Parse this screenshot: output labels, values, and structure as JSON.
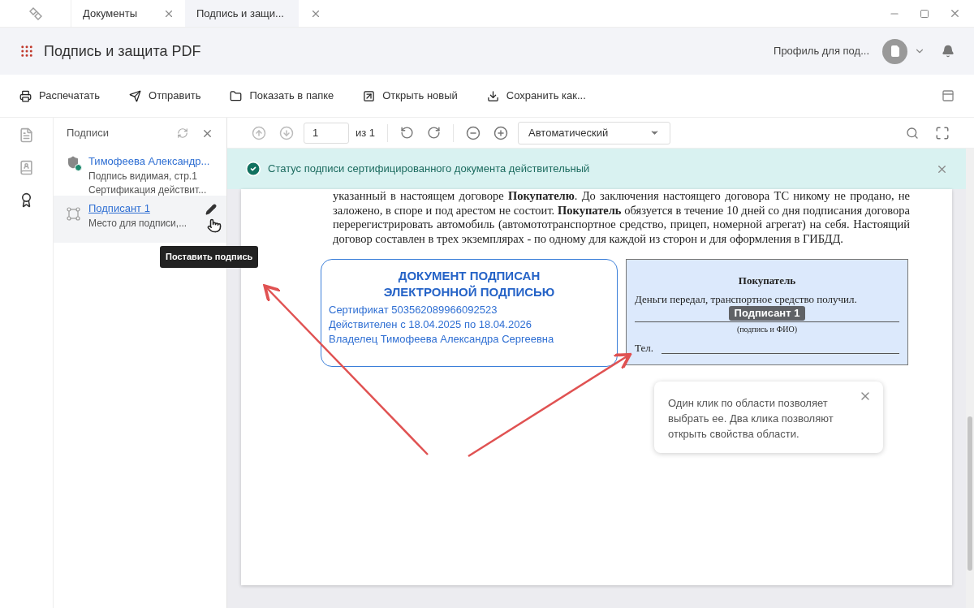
{
  "tabs": [
    {
      "label": "Документы",
      "selected": false
    },
    {
      "label": "Подпись и защи...",
      "selected": true
    }
  ],
  "header": {
    "title": "Подпись и защита PDF",
    "profile": "Профиль для под..."
  },
  "toolbar": [
    {
      "kind": "print",
      "label": "Распечатать"
    },
    {
      "kind": "send",
      "label": "Отправить"
    },
    {
      "kind": "folder",
      "label": "Показать в папке"
    },
    {
      "kind": "open",
      "label": "Открыть новый"
    },
    {
      "kind": "save",
      "label": "Сохранить как..."
    }
  ],
  "rail": [
    {
      "kind": "document",
      "selected": false
    },
    {
      "kind": "signers",
      "selected": false
    },
    {
      "kind": "certificate",
      "selected": true
    }
  ],
  "panel": {
    "title": "Подписи",
    "items": [
      {
        "kind": "signature",
        "name": "Тимофеева Александр...",
        "lines": [
          "Подпись видимая, стр.1",
          "Сертификация действит..."
        ],
        "selected": false
      },
      {
        "kind": "field",
        "name": "Подписант 1",
        "lines": [
          "Место для подписи,..."
        ],
        "selected": true
      }
    ],
    "tooltip": "Поставить подпись"
  },
  "viewer": {
    "page": "1",
    "page_count": "из 1",
    "zoom": "Автоматический"
  },
  "banner": "Статус подписи сертифицированного документа действительный",
  "document": {
    "paragraph": "указанный в настоящем договоре **Покупателю**. До заключения настоящего договора ТС никому не продано, не заложено, в споре и под арестом не состоит. **Покупатель** обязуется в течение 10 дней со дня подписания договора перерегистрировать автомобиль (автомототранспортное средство, прицеп, номерной агрегат) на себя. Настоящий договор составлен в трех экземплярах - по одному для каждой из сторон и для оформления в ГИБДД.",
    "stamp": {
      "title_lines": [
        "ДОКУМЕНТ ПОДПИСАН",
        "ЭЛЕКТРОННОЙ ПОДПИСЬЮ"
      ],
      "lines": [
        "Сертификат 503562089966092523",
        "Действителен с 18.04.2025 по 18.04.2026",
        "Владелец Тимофеева Александра Сергеевна"
      ]
    },
    "buyer": {
      "title": "Покупатель",
      "text": "Деньги  передал, транспортное средство получил.",
      "field_label": "Подписант 1",
      "caption": "(подпись и ФИО)",
      "phone": "Тел."
    },
    "hint": "Один клик по области позволяет выбрать ее. Два клика позволяют открыть свойства области."
  }
}
